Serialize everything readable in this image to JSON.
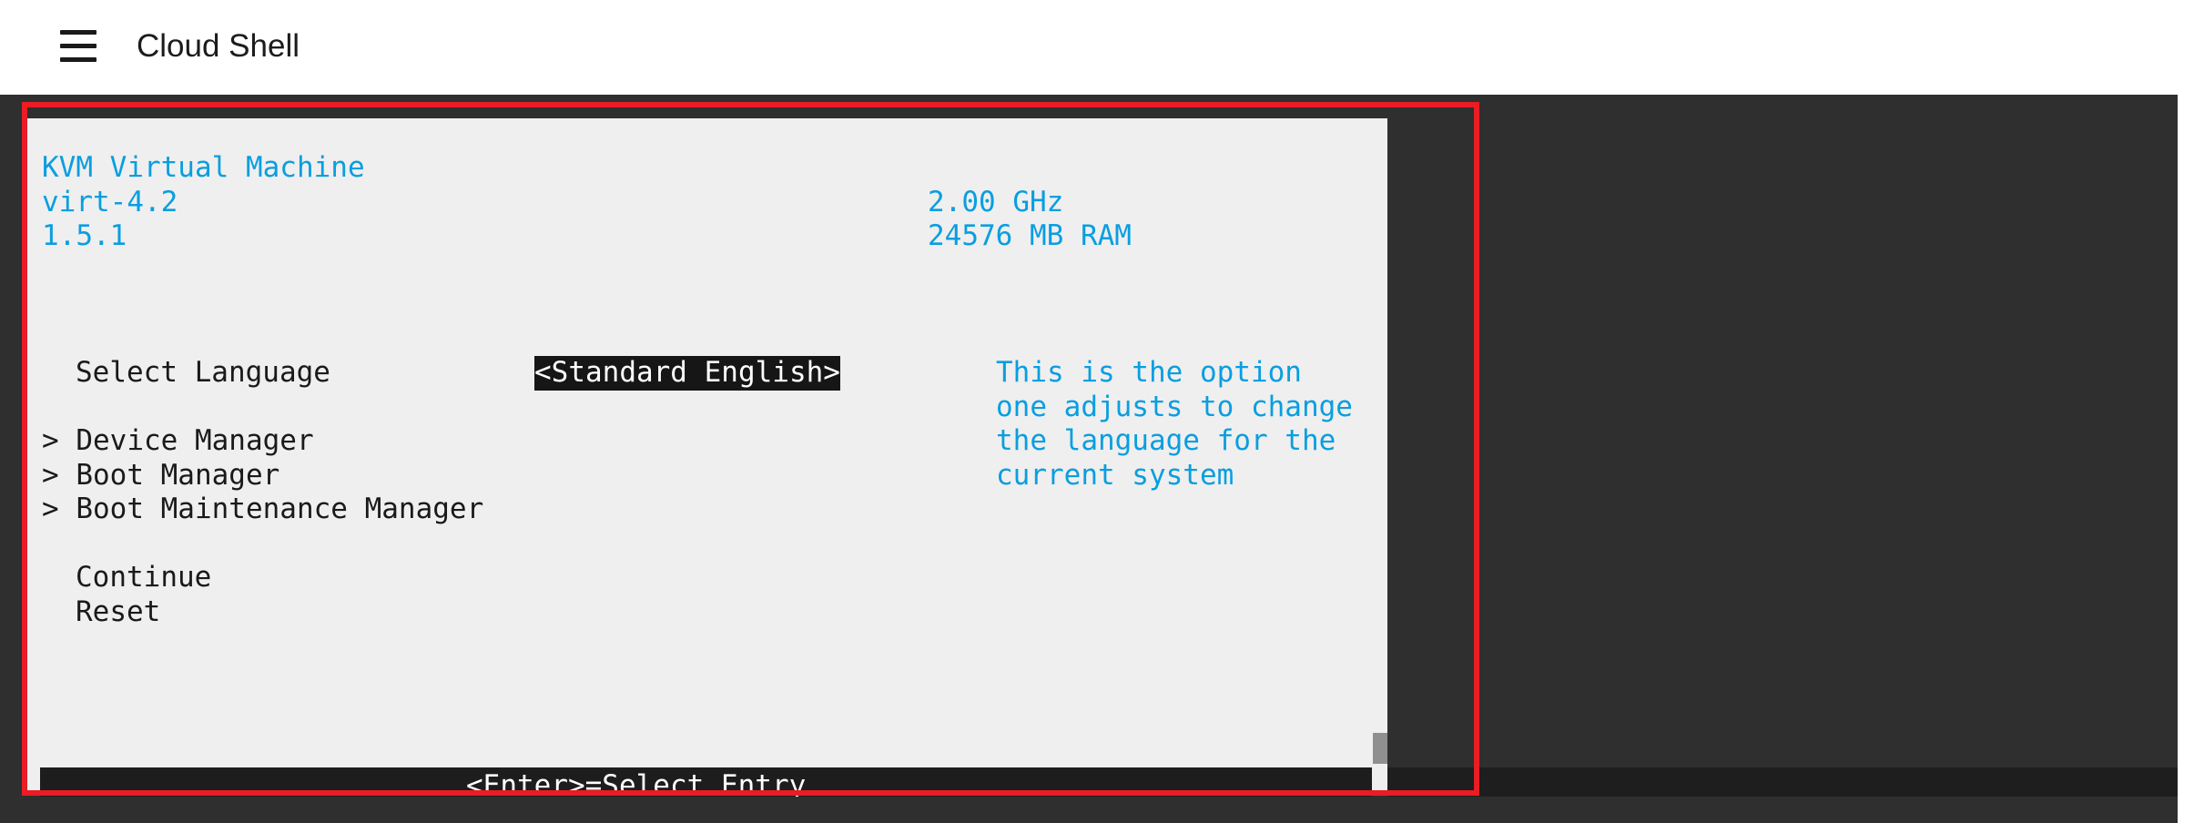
{
  "header": {
    "title": "Cloud Shell",
    "menu_icon": "hamburger-menu-icon"
  },
  "terminal": {
    "machine_name": "KVM Virtual Machine",
    "machine_version": "virt-4.2",
    "firmware_version": "1.5.1",
    "cpu_speed": "2.00 GHz",
    "memory": "24576 MB RAM",
    "menu": {
      "select_language_label": "Select Language",
      "language_value": "<Standard English>",
      "items": [
        {
          "prefix": "> ",
          "label": "Device Manager"
        },
        {
          "prefix": "> ",
          "label": "Boot Manager"
        },
        {
          "prefix": "> ",
          "label": "Boot Maintenance Manager"
        }
      ],
      "continue_label": "Continue",
      "reset_label": "Reset"
    },
    "help_text": [
      "This is the option",
      "one adjusts to change",
      "the language for the",
      "current system"
    ],
    "status_bar": "<Enter>=Select Entry"
  },
  "colors": {
    "accent_cyan": "#0a9ee0",
    "highlight_red": "#ea1c24",
    "terminal_bg": "#efefef",
    "shell_bg": "#2f2f2f"
  }
}
